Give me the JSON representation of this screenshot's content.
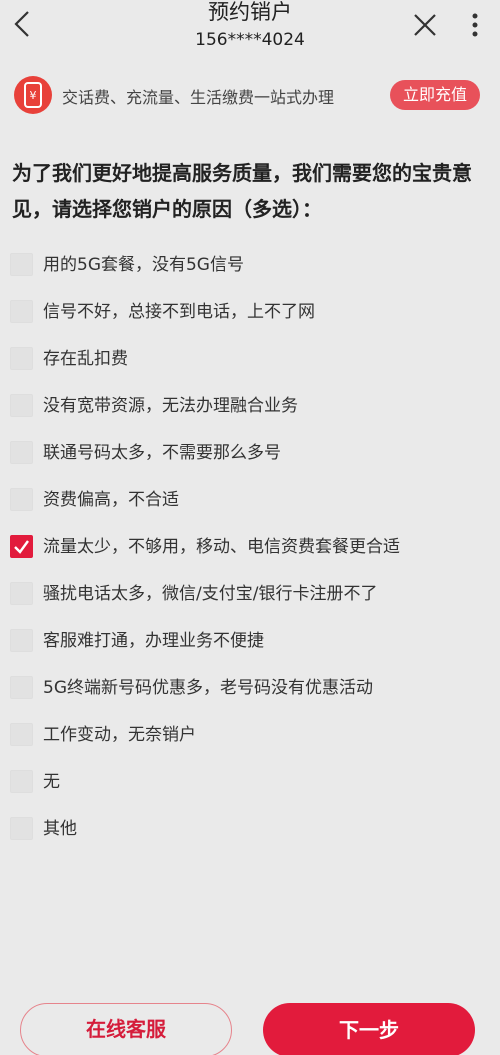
{
  "header": {
    "title": "预约销户",
    "phone": "156****4024",
    "back_icon": "chevron-left-icon",
    "close_icon": "close-icon",
    "more_icon": "more-vertical-icon"
  },
  "promo": {
    "icon": "phone-yen-icon",
    "text": "交话费、充流量、生活缴费一站式办理",
    "button_label": "立即充值"
  },
  "question": "为了我们更好地提高服务质量，我们需要您的宝贵意见，请选择您销户的原因（多选）：",
  "options": [
    {
      "label": "用的5G套餐，没有5G信号",
      "checked": false
    },
    {
      "label": "信号不好，总接不到电话，上不了网",
      "checked": false
    },
    {
      "label": "存在乱扣费",
      "checked": false
    },
    {
      "label": "没有宽带资源，无法办理融合业务",
      "checked": false
    },
    {
      "label": "联通号码太多，不需要那么多号",
      "checked": false
    },
    {
      "label": "资费偏高，不合适",
      "checked": false
    },
    {
      "label": "流量太少，不够用，移动、电信资费套餐更合适",
      "checked": true
    },
    {
      "label": "骚扰电话太多，微信/支付宝/银行卡注册不了",
      "checked": false
    },
    {
      "label": "客服难打通，办理业务不便捷",
      "checked": false
    },
    {
      "label": "5G终端新号码优惠多，老号码没有优惠活动",
      "checked": false
    },
    {
      "label": "工作变动，无奈销户",
      "checked": false
    },
    {
      "label": "无",
      "checked": false
    },
    {
      "label": "其他",
      "checked": false
    }
  ],
  "footer": {
    "service_label": "在线客服",
    "next_label": "下一步"
  },
  "colors": {
    "accent": "#e21b3c",
    "promo_button": "#e8515a",
    "background": "#eaeaea"
  }
}
